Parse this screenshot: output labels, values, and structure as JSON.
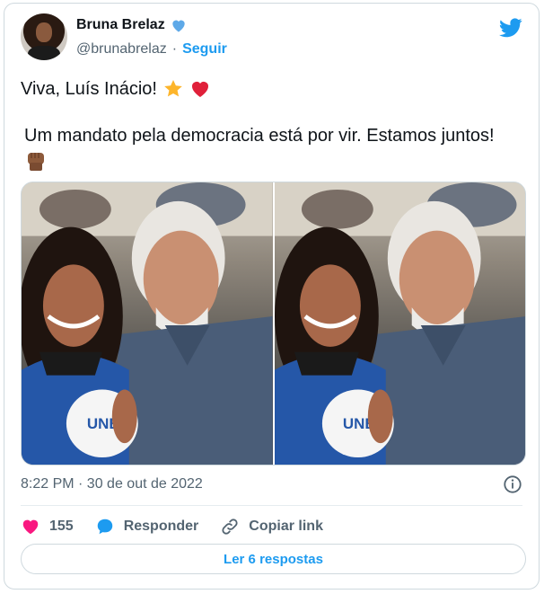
{
  "tweet": {
    "author": {
      "display_name": "Bruna Brelaz",
      "handle": "@brunabrelaz",
      "follow_label": "Seguir",
      "separator": "·"
    },
    "text_line1": "Viva, Luís Inácio!",
    "text_line2": "Um mandato pela democracia está por vir. Estamos juntos!",
    "emojis": [
      "star-emoji",
      "red-heart-emoji",
      "raised-fist-emoji"
    ],
    "photo_labels": [
      "UNE",
      "UNE"
    ],
    "timestamp": "8:22 PM · 30 de out de 2022",
    "likes_count": "155",
    "reply_label": "Responder",
    "copy_link_label": "Copiar link",
    "read_replies_label": "Ler 6 respostas"
  },
  "colors": {
    "accent": "#1d9bf0",
    "like": "#f91880",
    "text_secondary": "#536471",
    "border": "#cfd9de"
  }
}
